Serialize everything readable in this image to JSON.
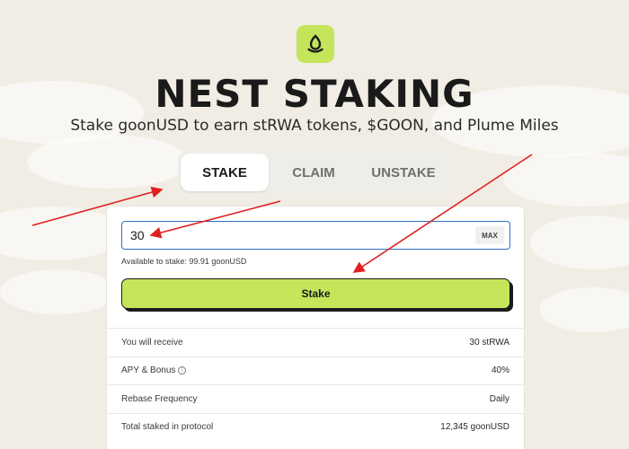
{
  "header": {
    "logo_icon": "nest-egg-logo-icon",
    "title": "NEST STAKING",
    "subtitle": "Stake goonUSD to earn stRWA tokens, $GOON, and Plume Miles"
  },
  "tabs": [
    {
      "label": "STAKE",
      "active": true
    },
    {
      "label": "CLAIM",
      "active": false
    },
    {
      "label": "UNSTAKE",
      "active": false
    }
  ],
  "stake_form": {
    "amount_value": "30",
    "max_label": "MAX",
    "available_text": "Available to stake: 99.91 goonUSD",
    "stake_button_label": "Stake"
  },
  "info": [
    {
      "label": "You will receive",
      "value": "30 stRWA"
    },
    {
      "label": "APY & Bonus",
      "value": "40%",
      "icon": "info-icon"
    },
    {
      "label": "Rebase Frequency",
      "value": "Daily"
    },
    {
      "label": "Total staked in protocol",
      "value": "12,345 goonUSD"
    }
  ],
  "colors": {
    "accent_lime": "#c5e55b",
    "background": "#f1ede4",
    "annotation_arrow": "#e02020",
    "input_focus": "#2f6fc4"
  }
}
